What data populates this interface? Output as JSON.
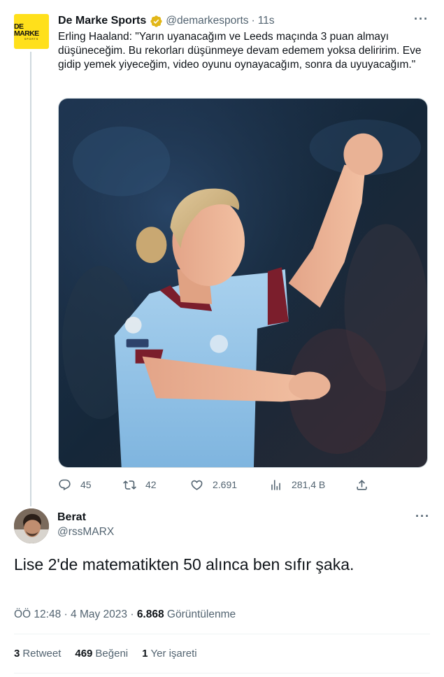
{
  "parent_tweet": {
    "logo": {
      "main": "DE MARKE",
      "sub": "SPORTS"
    },
    "author_name": "De Marke Sports",
    "handle": "@demarkesports",
    "separator": "·",
    "time": "11s",
    "more": "···",
    "text": "Erling Haaland: \"Yarın uyanacağım ve Leeds maçında 3 puan almayı düşüneceğim. Bu rekorları düşünmeye devam edemem yoksa deliririm. Eve gidip yemek yiyeceğim, video oyunu oynayacağım, sonra da uyuyacağım.\"",
    "actions": {
      "replies": "45",
      "retweets": "42",
      "likes": "2.691",
      "views": "281,4 B"
    },
    "icons": [
      "verified-badge-icon",
      "reply-icon",
      "retweet-icon",
      "like-icon",
      "views-icon",
      "share-icon"
    ]
  },
  "main_tweet": {
    "author_name": "Berat",
    "handle": "@rssMARX",
    "more": "···",
    "text": "Lise 2'de matematikten 50 alınca ben sıfır şaka.",
    "meta": {
      "time": "ÖÖ 12:48",
      "separator": "·",
      "date": "4 May 2023",
      "separator2": "·",
      "views_count": "6.868",
      "views_label": "Görüntülenme"
    },
    "stats": {
      "retweets_count": "3",
      "retweets_label": "Retweet",
      "likes_count": "469",
      "likes_label": "Beğeni",
      "bookmarks_count": "1",
      "bookmarks_label": "Yer işareti"
    }
  },
  "colors": {
    "text_primary": "#0f1419",
    "text_secondary": "#536471",
    "border": "#cfd9de",
    "logo_yellow": "#ffe01b",
    "verified_gold": "#e2b719"
  }
}
